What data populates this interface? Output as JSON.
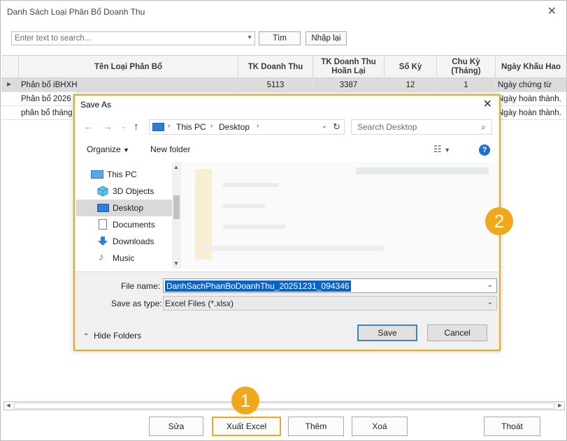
{
  "window": {
    "title": "Danh Sách Loại Phân Bổ Doanh Thu",
    "close_glyph": "✕"
  },
  "search": {
    "placeholder": "Enter text to search...",
    "find_label": "Tìm",
    "reset_label": "Nhập lại"
  },
  "grid": {
    "columns": [
      "Tên Loại Phân Bổ",
      "TK Doanh Thu",
      "TK Doanh Thu Hoãn Lại",
      "Số Kỳ",
      "Chu Kỳ (Tháng)",
      "Ngày Khấu Hao"
    ],
    "rows": [
      [
        "Phân bổ iBHXH",
        "5113",
        "3387",
        "12",
        "1",
        "Ngày chứng từ"
      ],
      [
        "Phân bổ 2026",
        "",
        "",
        "",
        "",
        "Ngày hoàn thành."
      ],
      [
        "phân bổ tháng 1",
        "",
        "",
        "",
        "",
        "Ngày hoàn thành."
      ]
    ]
  },
  "footer": {
    "edit_label": "Sửa",
    "export_label": "Xuất Excel",
    "add_label": "Thêm",
    "delete_label": "Xoá",
    "exit_label": "Thoát"
  },
  "badges": {
    "step1": "1",
    "step2": "2"
  },
  "save_dialog": {
    "title": "Save As",
    "address": [
      "This PC",
      "Desktop"
    ],
    "search_placeholder": "Search Desktop",
    "organize_label": "Organize",
    "new_folder_label": "New folder",
    "help_glyph": "?",
    "tree": [
      "This PC",
      "3D Objects",
      "Desktop",
      "Documents",
      "Downloads",
      "Music"
    ],
    "file_name_label": "File name:",
    "file_name_value": "DanhSachPhanBoDoanhThu_20251231_094346",
    "save_type_label": "Save as type:",
    "save_type_value": "Excel Files (*.xlsx)",
    "hide_folders_label": "Hide Folders",
    "save_label": "Save",
    "cancel_label": "Cancel"
  },
  "colors": {
    "highlight": "#f1a71a",
    "selection": "#0a64c8"
  }
}
